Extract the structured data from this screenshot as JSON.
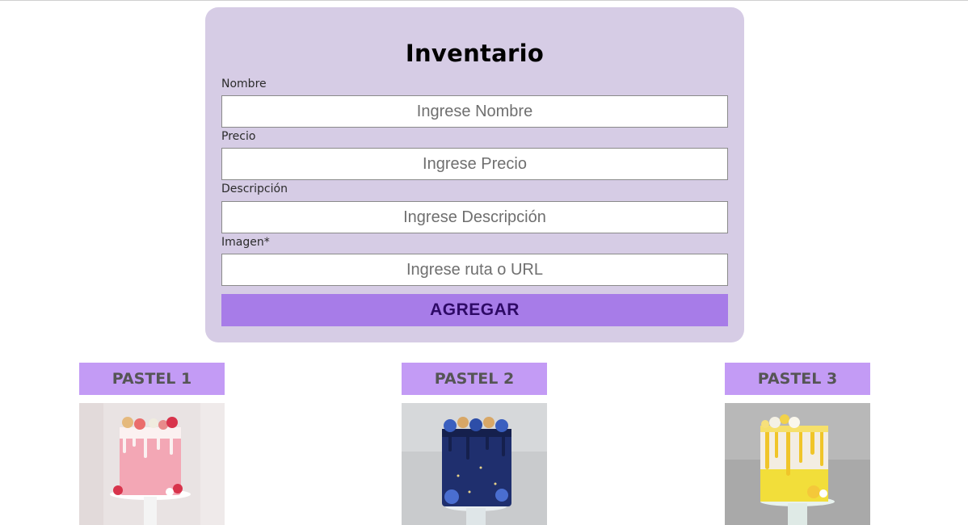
{
  "form": {
    "title": "Inventario",
    "fields": [
      {
        "label": "Nombre",
        "placeholder": "Ingrese Nombre",
        "value": ""
      },
      {
        "label": "Precio",
        "placeholder": "Ingrese Precio",
        "value": ""
      },
      {
        "label": "Descripción",
        "placeholder": "Ingrese Descripción",
        "value": ""
      },
      {
        "label": "Imagen*",
        "placeholder": "Ingrese ruta o URL",
        "value": ""
      }
    ],
    "submit_label": "AGREGAR"
  },
  "products": [
    {
      "title": "PASTEL 1",
      "image": "pink-drip-cake-with-strawberries"
    },
    {
      "title": "PASTEL 2",
      "image": "navy-blue-starry-drip-cake"
    },
    {
      "title": "PASTEL 3",
      "image": "yellow-drip-cake-with-lemon"
    }
  ],
  "colors": {
    "form_background": "#d6cce5",
    "button": "#a77ce8",
    "button_text": "#2e0a66",
    "product_header": "#c39bf5"
  }
}
